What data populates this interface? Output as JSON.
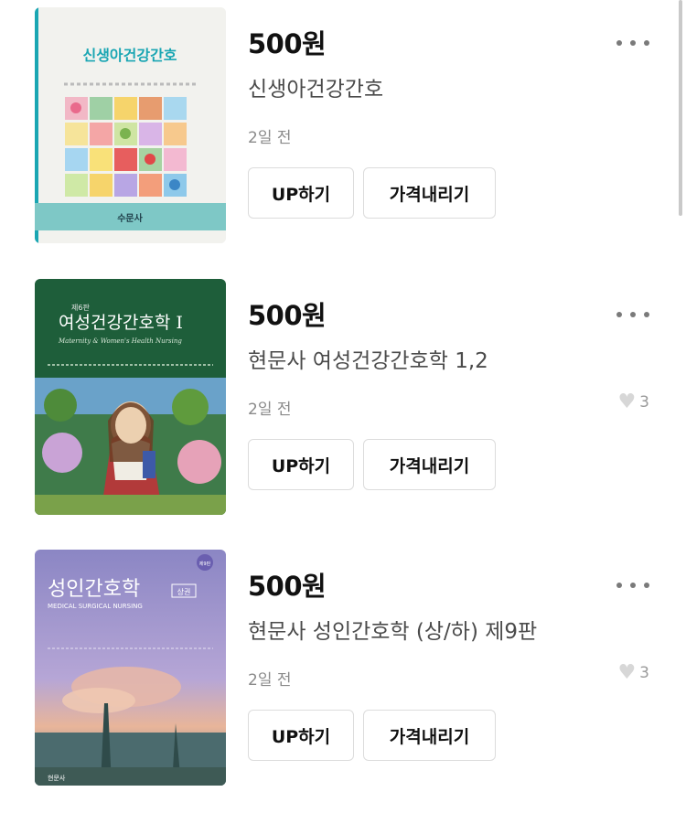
{
  "listings": [
    {
      "price": "500원",
      "title": "신생아건강간호",
      "time": "2일 전",
      "likes": "",
      "cover_title": "신생아건강간호",
      "cover_publisher": "수문사",
      "cover_bg": "#f2f2ee",
      "cover_accent": "#1aa6b3"
    },
    {
      "price": "500원",
      "title": "현문사 여성건강간호학 1,2",
      "time": "2일 전",
      "likes": "3",
      "cover_edition": "제6판",
      "cover_title": "여성건강간호학 I",
      "cover_subtitle": "Maternity & Women's Health Nursing",
      "cover_bg": "#1e5e3a"
    },
    {
      "price": "500원",
      "title": "현문사 성인간호학 (상/하) 제9판",
      "time": "2일 전",
      "likes": "3",
      "cover_edition": "제9판",
      "cover_title": "성인간호학",
      "cover_tag": "상권",
      "cover_subtitle": "MEDICAL SURGICAL NURSING",
      "cover_publisher": "현문사",
      "cover_bg": "#8b86c4"
    }
  ],
  "buttons": {
    "up_label": "UP하기",
    "down_label": "가격내리기"
  },
  "icons": {
    "more": "more-dots-icon",
    "heart": "heart-icon"
  }
}
